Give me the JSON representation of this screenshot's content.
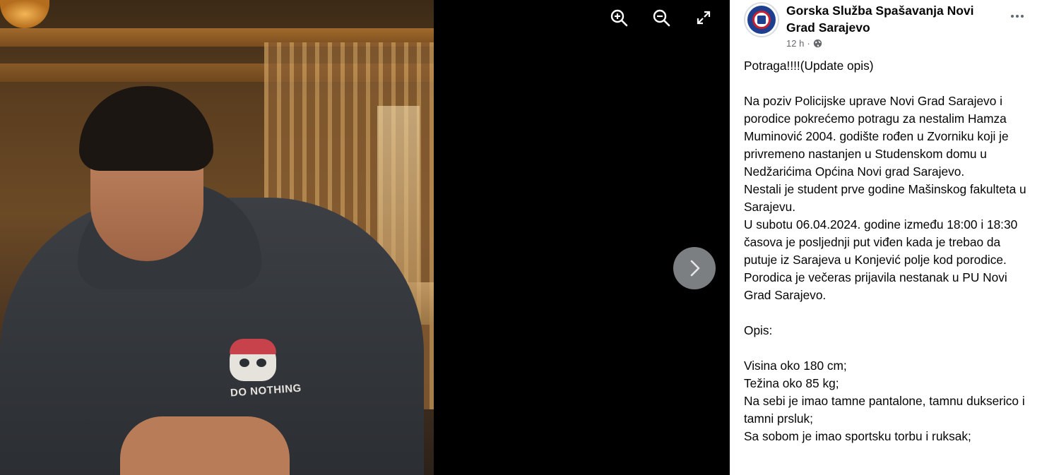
{
  "viewer": {
    "zoom_in_icon": "zoom-in-icon",
    "zoom_out_icon": "zoom-out-icon",
    "fullscreen_icon": "fullscreen-icon",
    "next_icon": "chevron-right-icon",
    "photo_print_text": "DO NOTHING"
  },
  "post": {
    "page_name": "Gorska Služba Spašavanja Novi Grad Sarajevo",
    "time": "12 h",
    "separator": "·",
    "audience_icon": "globe-icon",
    "lines": [
      "Potraga!!!!(Update opis)",
      "",
      "Na poziv Policijske uprave Novi Grad Sarajevo i porodice pokrećemo potragu za nestalim Hamza Muminović 2004. godište rođen u Zvorniku koji je privremeno nastanjen u Studenskom domu u Nedžarićima Općina Novi grad Sarajevo.",
      "Nestali je student prve godine Mašinskog fakulteta u Sarajevu.",
      "U subotu 06.04.2024. godine između 18:00 i 18:30 časova je posljednji put viđen kada je trebao da putuje iz Sarajeva u Konjević polje kod porodice.",
      "Porodica je večeras prijavila nestanak u PU Novi Grad Sarajevo.",
      "",
      "Opis:",
      "",
      "Visina oko 180 cm;",
      "Težina oko 85 kg;",
      "Na sebi je imao tamne pantalone, tamnu dukserico i tamni prsluk;",
      "Sa sobom je imao sportsku torbu i ruksak;"
    ]
  }
}
